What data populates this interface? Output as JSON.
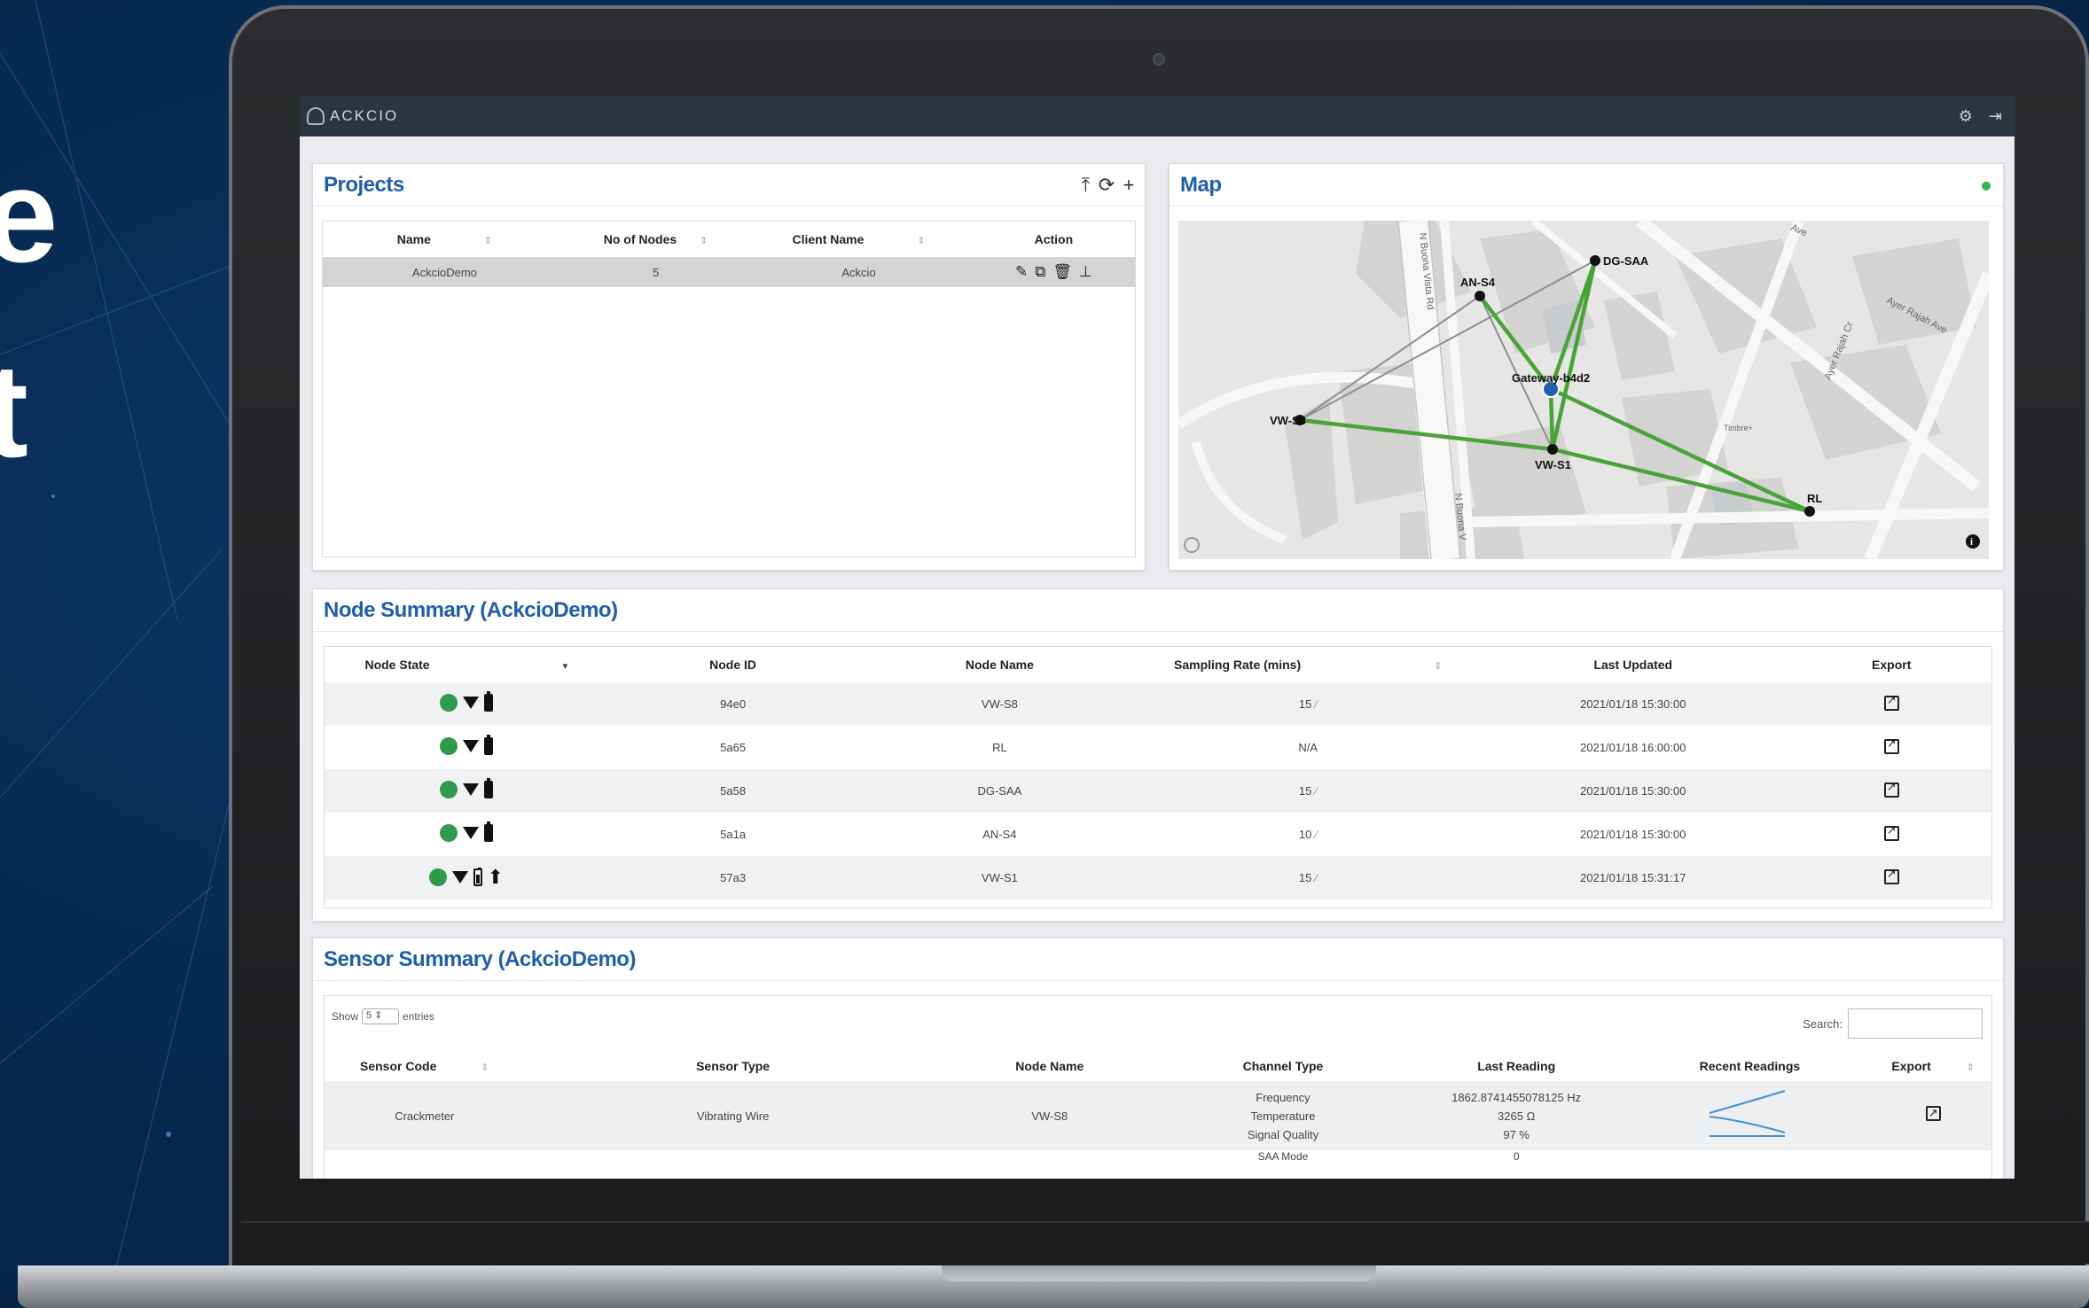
{
  "hero": {
    "fragment_1": "e",
    "fragment_2": "t"
  },
  "topbar": {
    "brand": "ACKCIO",
    "settings_icon": "gear-icon",
    "logout_icon": "logout-icon"
  },
  "projects": {
    "title": "Projects",
    "tools": {
      "upload": "⤒",
      "refresh": "⟳",
      "add": "+"
    },
    "columns": [
      "Name",
      "No of Nodes",
      "Client Name",
      "Action"
    ],
    "rows": [
      {
        "name": "AckcioDemo",
        "nodes": "5",
        "client": "Ackcio"
      }
    ]
  },
  "map": {
    "title": "Map",
    "status_color": "#37b34a",
    "streets": [
      "N Buona Vista Rd",
      "N Buona V",
      "Ayer Rajah Ave",
      "Ayer Rajah Cr",
      "Ave",
      "Timbre+"
    ],
    "nodes": [
      "DG-SAA",
      "AN-S4",
      "Gateway-b4d2",
      "VW-S8",
      "VW-S1",
      "RL"
    ]
  },
  "node_summary": {
    "title": "Node Summary (AckcioDemo)",
    "columns": [
      "Node State",
      "Node ID",
      "Node Name",
      "Sampling Rate (mins)",
      "Last Updated",
      "Export"
    ],
    "rows": [
      {
        "id": "94e0",
        "name": "VW-S8",
        "rate": "15",
        "updated": "2021/01/18 15:30:00",
        "plug": false
      },
      {
        "id": "5a65",
        "name": "RL",
        "rate": "N/A",
        "updated": "2021/01/18 16:00:00",
        "plug": false
      },
      {
        "id": "5a58",
        "name": "DG-SAA",
        "rate": "15",
        "updated": "2021/01/18 15:30:00",
        "plug": false
      },
      {
        "id": "5a1a",
        "name": "AN-S4",
        "rate": "10",
        "updated": "2021/01/18 15:30:00",
        "plug": false
      },
      {
        "id": "57a3",
        "name": "VW-S1",
        "rate": "15",
        "updated": "2021/01/18 15:31:17",
        "plug": true
      }
    ]
  },
  "sensor_summary": {
    "title": "Sensor Summary (AckcioDemo)",
    "show_label": "Show",
    "show_value": "5",
    "entries_label": "entries",
    "search_label": "Search:",
    "columns": [
      "Sensor Code",
      "Sensor Type",
      "Node Name",
      "Channel Type",
      "Last Reading",
      "Recent Readings",
      "Export"
    ],
    "row1": {
      "code": "Crackmeter",
      "type": "Vibrating Wire",
      "node": "VW-S8",
      "channels": [
        "Frequency",
        "Temperature",
        "Signal Quality"
      ],
      "readings": [
        "1862.8741455078125 Hz",
        "3265 Ω",
        "97 %"
      ]
    },
    "row2": {
      "channel": "SAA Mode",
      "reading": "0"
    }
  }
}
